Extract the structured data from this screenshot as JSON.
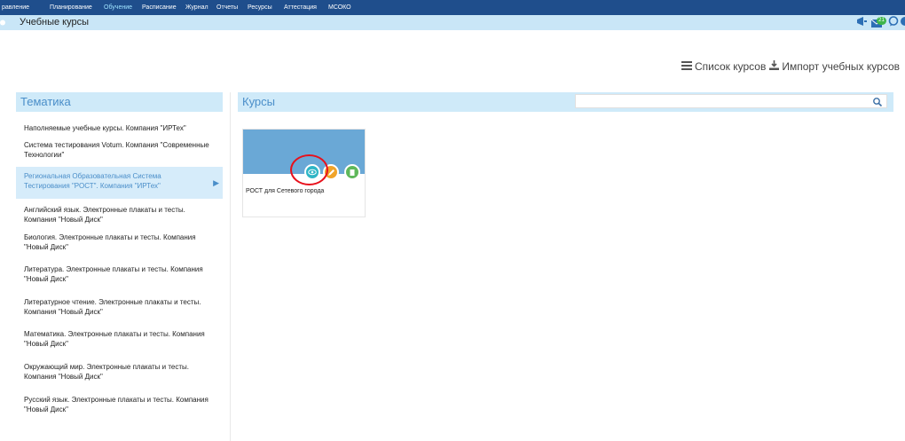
{
  "nav": {
    "items": [
      "равление",
      "Планирование",
      "Обучение",
      "Расписание",
      "Журнал",
      "Отчеты",
      "Ресурсы",
      "Аттестация",
      "МСОКО"
    ],
    "active": "Обучение"
  },
  "subbar": {
    "title": "Учебные курсы",
    "badge_count": "21"
  },
  "actions": {
    "list_label": "Список курсов",
    "import_label": "Импорт учебных курсов"
  },
  "topics": {
    "header": "Тематика",
    "items": [
      "Наполняемые учебные курсы. Компания \"ИРТех\"",
      "Система тестирования Votum. Компания \"Современные Технологии\"",
      "Региональная Образовательная Система Тестирования \"РОСТ\". Компания \"ИРТех\"",
      "Английский язык. Электронные плакаты и тесты. Компания \"Новый Диск\"",
      "Биология. Электронные плакаты и тесты. Компания \"Новый Диск\"",
      "Литература. Электронные плакаты и тесты. Компания \"Новый Диск\"",
      "Литературное чтение. Электронные плакаты и тесты. Компания \"Новый Диск\"",
      "Математика. Электронные плакаты и тесты. Компания \"Новый Диск\"",
      "Окружающий мир. Электронные плакаты и тесты. Компания \"Новый Диск\"",
      "Русский язык. Электронные плакаты и тесты. Компания \"Новый Диск\""
    ],
    "selected_index": 2
  },
  "courses": {
    "header": "Курсы",
    "search_value": "",
    "cards": [
      {
        "name": "РОСТ для Сетевого города"
      }
    ]
  },
  "colors": {
    "nav_bg": "#1f4e8c",
    "subbar_bg": "#c9e6f7",
    "panel_header_bg": "#cfeaf9",
    "accent_text": "#4a8ec9",
    "thumb_bg": "#6aa8d6",
    "view_btn": "#2fb6c6",
    "edit_btn": "#f0a42a",
    "delete_btn": "#5fb85a",
    "annotation_red": "#e8101b"
  }
}
